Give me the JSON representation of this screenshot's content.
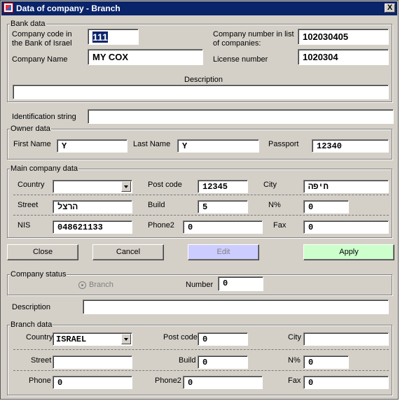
{
  "window": {
    "title": "Data of company - Branch",
    "close_glyph": "X",
    "icon": "app-icon"
  },
  "bank": {
    "group_title": "Bank data",
    "company_code_label": "Company code in the Bank of Israel",
    "company_code_value": "111",
    "company_number_label": "Company number in list of companies:",
    "company_number_value": "102030405",
    "company_name_label": "Company Name",
    "company_name_value": "MY COX",
    "license_label": "License number",
    "license_value": "1020304",
    "description_label": "Description",
    "description_value": ""
  },
  "identification": {
    "label": "Identification string",
    "value": ""
  },
  "owner": {
    "group_title": "Owner data",
    "first_name_label": "First Name",
    "first_name_value": "Y",
    "last_name_label": "Last Name",
    "last_name_value": "Y",
    "passport_label": "Passport",
    "passport_value": "12340"
  },
  "main": {
    "group_title": "Main company data",
    "country_label": "Country",
    "country_value": "",
    "post_code_label": "Post code",
    "post_code_value": "12345",
    "city_label": "City",
    "city_value": "חיפה",
    "street_label": "Street",
    "street_value": "הרצל",
    "build_label": "Build",
    "build_value": "5",
    "percent_label": "N%",
    "percent_value": "0",
    "nis_label": "NIS",
    "nis_value": "048621133",
    "phone2_label": "Phone2",
    "phone2_value": "0",
    "fax_label": "Fax",
    "fax_value": "0"
  },
  "buttons": {
    "close": "Close",
    "cancel": "Cancel",
    "edit": "Edit",
    "apply": "Apply"
  },
  "status": {
    "group_title": "Company status",
    "branch_label": "Branch",
    "number_label": "Number",
    "number_value": "0"
  },
  "description": {
    "label": "Description",
    "value": ""
  },
  "branch": {
    "group_title": "Branch data",
    "country_label": "Country",
    "country_value": "ISRAEL",
    "post_code_label": "Post code",
    "post_code_value": "0",
    "city_label": "City",
    "city_value": "",
    "street_label": "Street",
    "street_value": "",
    "build_label": "Build",
    "build_value": "0",
    "percent_label": "N%",
    "percent_value": "0",
    "phone_label": "Phone",
    "phone_value": "0",
    "phone2_label": "Phone2",
    "phone2_value": "0",
    "fax_label": "Fax",
    "fax_value": "0"
  },
  "colors": {
    "titlebar": "#0a246a",
    "face": "#d4d0c8",
    "apply_bg": "#ccffcc",
    "edit_bg": "#ccccff"
  }
}
